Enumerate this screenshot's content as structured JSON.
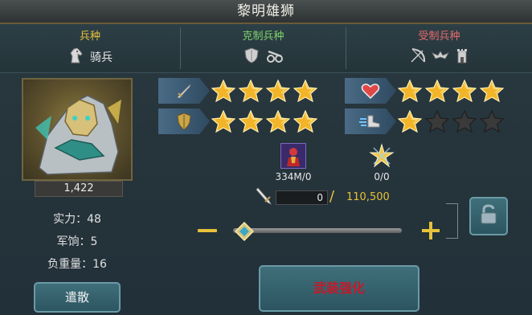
{
  "title": "黎明雄狮",
  "classes": {
    "unit_type": {
      "label": "兵种",
      "value": "骑兵",
      "color": "#e8c23a"
    },
    "counters": {
      "label": "克制兵种",
      "color": "#7fd36b"
    },
    "countered_by": {
      "label": "受制兵种",
      "color": "#e86b6b"
    }
  },
  "hero": {
    "power_badge": "1,422",
    "stats": [
      {
        "text": "实力：48"
      },
      {
        "text": "军饷：5"
      },
      {
        "text": "负重量：16"
      }
    ],
    "dismiss_label": "遣散"
  },
  "attributes": {
    "attack_stars": 4,
    "defense_stars": 4,
    "hp_stars": 4,
    "speed_stars": 1,
    "max_stars": 4
  },
  "resources": {
    "troop_count": "334M/0",
    "medal_count": "0/0"
  },
  "enhance": {
    "input_value": "0",
    "max_value": "110,500",
    "slider_level": 0,
    "button_label": "武装强化"
  },
  "colors": {
    "star_active": "#f2b52a",
    "star_inactive": "#3a3a3a",
    "max_value_color": "#e8c23a",
    "button_text": "#c41a2a"
  }
}
